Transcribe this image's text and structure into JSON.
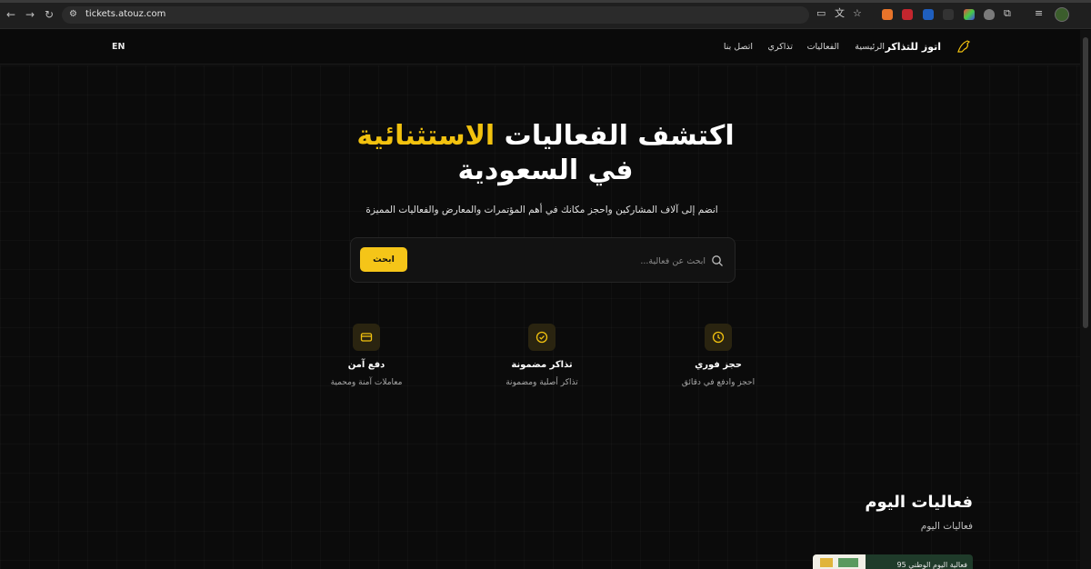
{
  "browser": {
    "url": "tickets.atouz.com"
  },
  "header": {
    "brand": "اتوز للتذاكر",
    "nav": [
      "الرئيسية",
      "الفعاليات",
      "تذاكري",
      "اتصل بنا"
    ],
    "lang_toggle": "EN",
    "accent_color": "#f5c518"
  },
  "hero": {
    "title_part1": "اكتشف الفعاليات",
    "title_highlight": "الاستثنائية",
    "title_line2": "في السعودية",
    "subtitle": "انضم إلى آلاف المشاركين واحجز مكانك في أهم المؤتمرات والمعارض والفعاليات المميزة",
    "search": {
      "placeholder": "ابحث عن فعالية...",
      "button_label": "ابحث"
    }
  },
  "features": [
    {
      "icon": "clock-icon",
      "title": "حجز فوري",
      "desc": "احجز وادفع في دقائق"
    },
    {
      "icon": "check-circle-icon",
      "title": "تذاكر مضمونة",
      "desc": "تذاكر أصلية ومضمونة"
    },
    {
      "icon": "credit-card-icon",
      "title": "دفع آمن",
      "desc": "معاملات آمنة ومحمية"
    }
  ],
  "today": {
    "title": "فعاليات اليوم",
    "subtitle": "فعاليات اليوم",
    "card_label": "فعالية اليوم الوطني 95"
  }
}
